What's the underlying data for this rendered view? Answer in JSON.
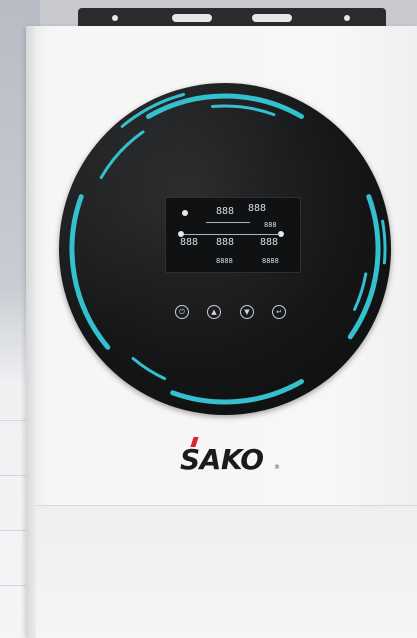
{
  "product": {
    "brand": "SAKO",
    "brand_mark": "®",
    "type": "wall-mounted hybrid solar inverter"
  },
  "display": {
    "lcd_segments": [
      "888",
      "888",
      "888",
      "888",
      "888",
      "8888",
      "888",
      "8888"
    ],
    "ring_color": "#35c0cf",
    "disc_color": "#141516"
  },
  "controls": {
    "buttons": [
      {
        "name": "power-button",
        "icon": "power-icon",
        "glyph": "⏻"
      },
      {
        "name": "up-button",
        "icon": "up-arrow-icon",
        "glyph": "▲"
      },
      {
        "name": "down-button",
        "icon": "down-arrow-icon",
        "glyph": "▼"
      },
      {
        "name": "enter-button",
        "icon": "enter-icon",
        "glyph": "↵"
      }
    ]
  },
  "colors": {
    "case": "#f6f6f6",
    "bracket": "#2b2c2e",
    "logo_accent": "#d8262c",
    "logo_text": "#1a1b1c"
  }
}
